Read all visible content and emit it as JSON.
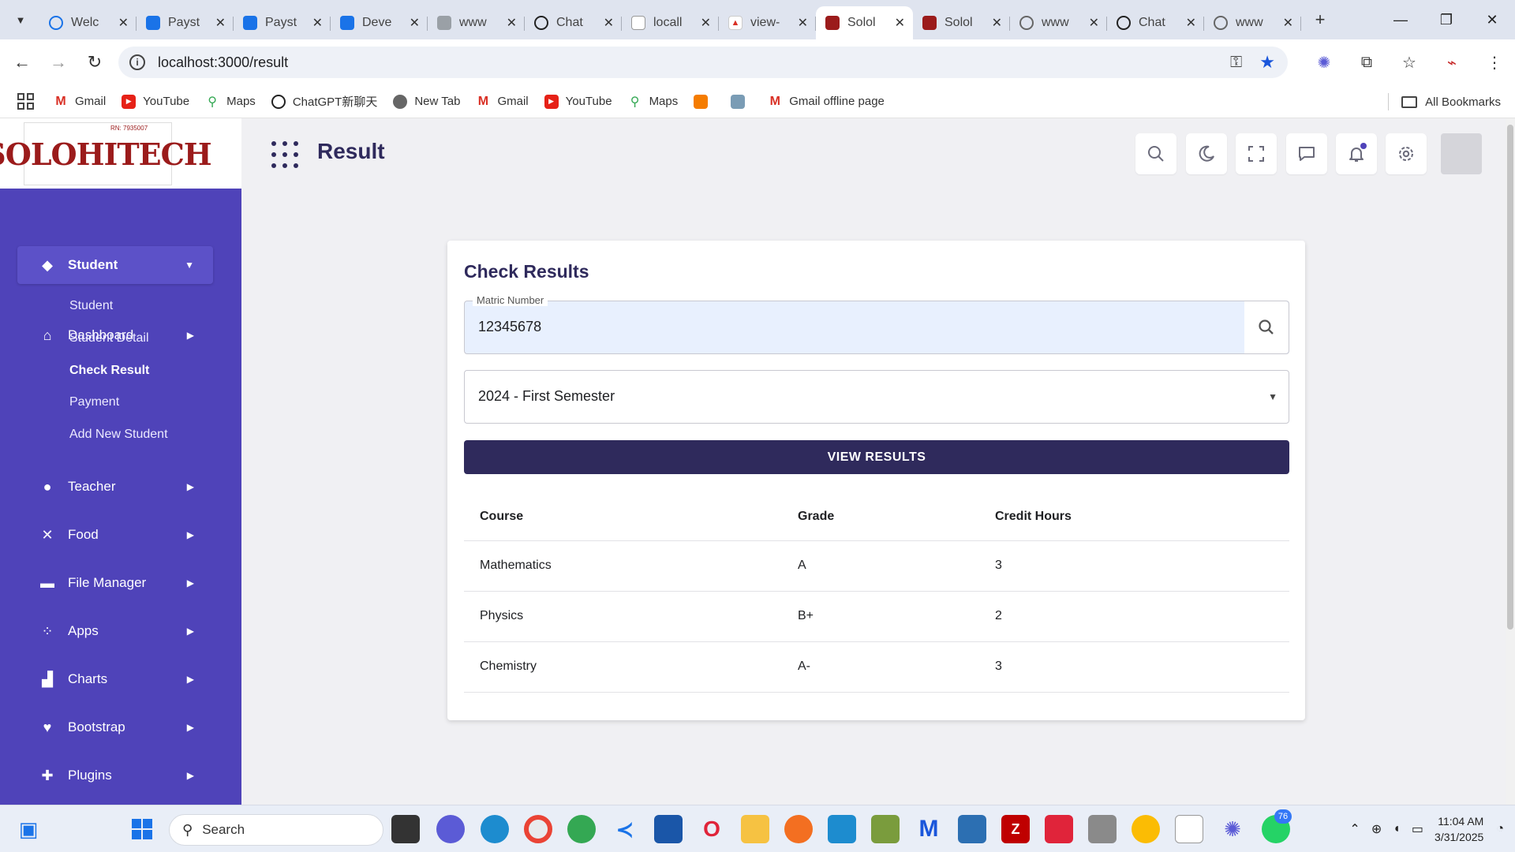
{
  "browser": {
    "tabs": [
      {
        "title": "Welc",
        "icon": "loading-icon"
      },
      {
        "title": "Payst",
        "icon": "doc-icon"
      },
      {
        "title": "Payst",
        "icon": "doc-icon"
      },
      {
        "title": "Deve",
        "icon": "doc-icon"
      },
      {
        "title": "www",
        "icon": "puzzle-icon"
      },
      {
        "title": "Chat",
        "icon": "chatgpt-icon"
      },
      {
        "title": "locall",
        "icon": "page-icon"
      },
      {
        "title": "view-",
        "icon": "pdf-icon"
      },
      {
        "title": "Solol",
        "icon": "soloh-icon"
      },
      {
        "title": "Solol",
        "icon": "soloh-icon"
      },
      {
        "title": "www",
        "icon": "globe-icon"
      },
      {
        "title": "Chat",
        "icon": "chatgpt-icon"
      },
      {
        "title": "www",
        "icon": "globe-icon"
      }
    ],
    "active_tab_index": 8,
    "url": "localhost:3000/result",
    "bookmarks": [
      {
        "label": "Gmail",
        "icon": "gmail-icon"
      },
      {
        "label": "YouTube",
        "icon": "youtube-icon"
      },
      {
        "label": "Maps",
        "icon": "maps-icon"
      },
      {
        "label": "ChatGPT新聊天",
        "icon": "chatgpt-icon"
      },
      {
        "label": "New Tab",
        "icon": "globe-icon"
      },
      {
        "label": "Gmail",
        "icon": "gmail-icon"
      },
      {
        "label": "YouTube",
        "icon": "youtube-icon"
      },
      {
        "label": "Maps",
        "icon": "maps-icon"
      },
      {
        "label": "",
        "icon": "box-icon"
      },
      {
        "label": "",
        "icon": "image-icon"
      },
      {
        "label": "Gmail offline page",
        "icon": "gmail-icon"
      }
    ],
    "all_bookmarks_label": "All Bookmarks"
  },
  "brand": {
    "logo_text": "SOLOHITECH",
    "logo_subtext": "RN: 7935007"
  },
  "sidebar": {
    "items": [
      {
        "label": "Dashboard",
        "icon": "home-icon",
        "expanded": false
      },
      {
        "label": "Student",
        "icon": "graduation-cap-icon",
        "expanded": true
      },
      {
        "label": "Teacher",
        "icon": "person-icon",
        "expanded": false
      },
      {
        "label": "Food",
        "icon": "utensils-icon",
        "expanded": false
      },
      {
        "label": "File Manager",
        "icon": "folder-icon",
        "expanded": false
      },
      {
        "label": "Apps",
        "icon": "apps-icon",
        "expanded": false
      },
      {
        "label": "Charts",
        "icon": "bar-chart-icon",
        "expanded": false
      },
      {
        "label": "Bootstrap",
        "icon": "heart-icon",
        "expanded": false
      },
      {
        "label": "Plugins",
        "icon": "puzzle-icon",
        "expanded": false
      }
    ],
    "student_subitems": [
      "Student",
      "Student Detail",
      "Check Result",
      "Payment",
      "Add New Student"
    ],
    "current_subitem": "Check Result"
  },
  "header": {
    "title": "Result",
    "buttons": [
      "search-icon",
      "moon-icon",
      "fullscreen-icon",
      "chat-icon",
      "bell-icon",
      "gear-icon"
    ]
  },
  "card": {
    "title": "Check Results",
    "matric_label": "Matric Number",
    "matric_value": "12345678",
    "semester_value": "2024 - First Semester",
    "view_button": "VIEW RESULTS",
    "table": {
      "headers": [
        "Course",
        "Grade",
        "Credit Hours"
      ],
      "rows": [
        [
          "Mathematics",
          "A",
          "3"
        ],
        [
          "Physics",
          "B+",
          "2"
        ],
        [
          "Chemistry",
          "A-",
          "3"
        ]
      ]
    }
  },
  "taskbar": {
    "search_placeholder": "Search",
    "whatsapp_badge": "76",
    "time": "11:04 AM",
    "date": "3/31/2025"
  },
  "colors": {
    "sidebar": "#4f43b9",
    "primary_dark": "#2f2a5c",
    "input_fill": "#e8f0fe"
  }
}
